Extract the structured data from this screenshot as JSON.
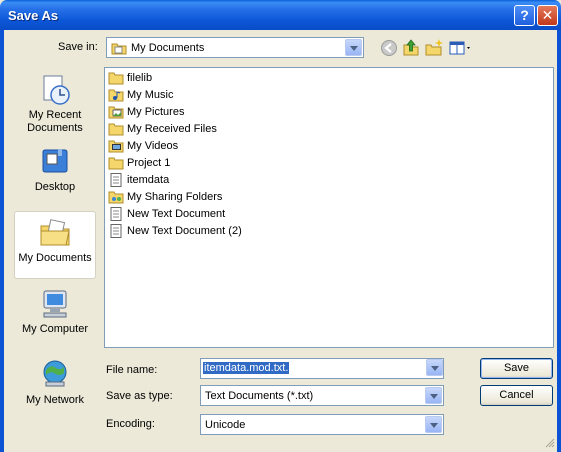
{
  "window": {
    "title": "Save As",
    "help_glyph": "?",
    "close_glyph": "✕"
  },
  "toolbar": {
    "save_in_label": "Save in:",
    "save_in_value": "My Documents",
    "icons": [
      "back-icon",
      "up-folder-icon",
      "new-folder-icon",
      "views-menu-icon"
    ]
  },
  "places": [
    {
      "label": "My Recent Documents",
      "icon": "recent-documents-icon"
    },
    {
      "label": "Desktop",
      "icon": "desktop-icon"
    },
    {
      "label": "My Documents",
      "icon": "my-documents-icon",
      "selected": true
    },
    {
      "label": "My Computer",
      "icon": "my-computer-icon"
    },
    {
      "label": "My Network",
      "icon": "my-network-icon"
    }
  ],
  "files": [
    {
      "name": "filelib",
      "type": "folder"
    },
    {
      "name": "My Music",
      "type": "music-folder"
    },
    {
      "name": "My Pictures",
      "type": "pictures-folder"
    },
    {
      "name": "My Received Files",
      "type": "folder"
    },
    {
      "name": "My Videos",
      "type": "videos-folder"
    },
    {
      "name": "Project 1",
      "type": "folder"
    },
    {
      "name": "itemdata",
      "type": "text-file"
    },
    {
      "name": "My Sharing Folders",
      "type": "sharing-folder"
    },
    {
      "name": "New Text Document",
      "type": "text-file"
    },
    {
      "name": "New Text Document (2)",
      "type": "text-file"
    }
  ],
  "form": {
    "file_name_label": "File name:",
    "file_name_value": "itemdata.mod.txt.",
    "save_as_type_label": "Save as type:",
    "save_as_type_value": "Text Documents (*.txt)",
    "encoding_label": "Encoding:",
    "encoding_value": "Unicode"
  },
  "buttons": {
    "save": "Save",
    "cancel": "Cancel"
  },
  "colors": {
    "title_bar": "#0b56d6",
    "selection": "#316ac5",
    "folder": "#f5d66b"
  }
}
